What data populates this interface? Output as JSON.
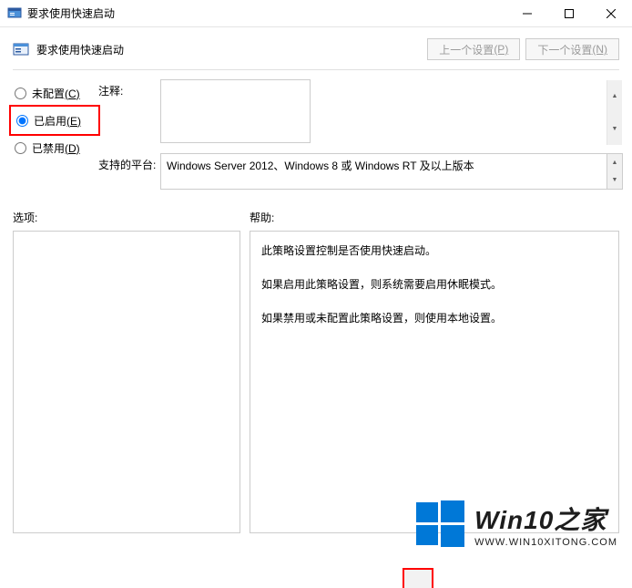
{
  "window": {
    "title": "要求使用快速启动"
  },
  "header": {
    "title": "要求使用快速启动",
    "prev_label": "上一个设置",
    "prev_accesskey": "(P)",
    "next_label": "下一个设置",
    "next_accesskey": "(N)"
  },
  "radios": {
    "not_configured": "未配置",
    "not_configured_key": "(C)",
    "enabled": "已启用",
    "enabled_key": "(E)",
    "disabled": "已禁用",
    "disabled_key": "(D)",
    "selected": "enabled"
  },
  "fields": {
    "comment_label": "注释:",
    "comment_value": "",
    "platform_label": "支持的平台:",
    "platform_value": "Windows Server 2012、Windows 8 或 Windows RT 及以上版本"
  },
  "sections": {
    "options_label": "选项:",
    "help_label": "帮助:"
  },
  "help": {
    "p1": "此策略设置控制是否使用快速启动。",
    "p2": "如果启用此策略设置，则系统需要启用休眠模式。",
    "p3": "如果禁用或未配置此策略设置，则使用本地设置。"
  },
  "watermark": {
    "main": "Win10之家",
    "sub": "WWW.WIN10XITONG.COM"
  }
}
